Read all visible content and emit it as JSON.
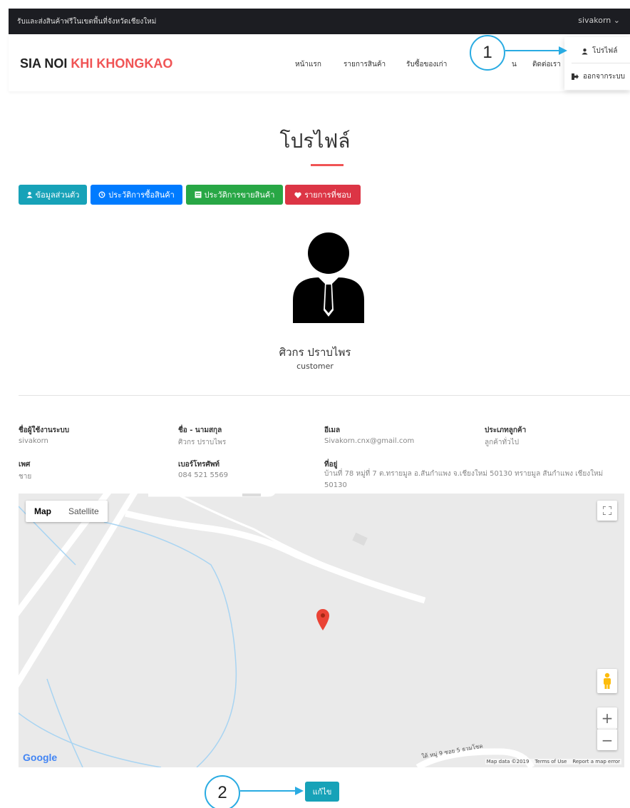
{
  "topbar": {
    "promo": "รับและส่งสินค้าฟรีในเขตพื้นที่จังหวัดเชียงใหม่",
    "username": "sivakorn",
    "caret": "⌄"
  },
  "logo": {
    "part1": "SIA NOI ",
    "part2": "KHI KHONGKAO"
  },
  "nav": {
    "home": "หน้าแรก",
    "products": "รายการสินค้า",
    "buy_old": "รับซื้อของเก่า",
    "obscured": "น",
    "contact": "ติดต่อเรา"
  },
  "dropdown": {
    "profile": "โปรไฟล์",
    "logout": "ออกจากระบบ"
  },
  "page": {
    "title": "โปรไฟล์"
  },
  "tabs": {
    "personal": "ข้อมูลส่วนตัว",
    "purchase_history": "ประวัติการซื้อสินค้า",
    "sales_history": "ประวัติการขายสินค้า",
    "favorites": "รายการที่ชอบ"
  },
  "profile": {
    "name": "ศิวกร ปราบไพร",
    "role": "customer"
  },
  "info": {
    "username_label": "ชื่อผู้ใช้งานระบบ",
    "username": "sivakorn",
    "fullname_label": "ชื่อ - นามสกุล",
    "fullname": "ศิวกร ปราบไพร",
    "email_label": "อีเมล",
    "email": "Sivakorn.cnx@gmail.com",
    "customer_type_label": "ประเภทลูกค้า",
    "customer_type": "ลูกค้าทั่วไป",
    "gender_label": "เพศ",
    "gender": "ชาย",
    "phone_label": "เบอร์โทรศัพท์",
    "phone": "084 521 5569",
    "address_label": "ที่อยู่",
    "address": "บ้านที่ 78 หมู่ที่ 7 ต.ทรายมูล อ.สันกำแพง จ.เชียงใหม่ 50130 ทรายมูล สันกำแพง เชียงใหม่ 50130"
  },
  "map": {
    "map_label": "Map",
    "satellite_label": "Satellite",
    "zoom_in": "+",
    "zoom_out": "−",
    "google": "Google",
    "data": "Map data ©2019",
    "terms": "Terms of Use",
    "report": "Report a map error",
    "road_label": "ใต้ หมู่ 9 ซอย 5 ธวมโชค"
  },
  "edit_button": "แก้ไข",
  "callouts": {
    "one": "1",
    "two": "2"
  },
  "colors": {
    "accent": "#f05455",
    "personal": "#17a2b8",
    "purchase": "#007bff",
    "sales": "#28a745",
    "favorites": "#dc3545",
    "callout": "#29abe2"
  },
  "icons": {
    "personal": "user-icon",
    "purchase": "history-icon",
    "sales": "list-icon",
    "favorites": "heart-icon",
    "profile": "user-icon",
    "logout": "sign-out-icon",
    "fullscreen": "fullscreen-icon",
    "pegman": "pegman-icon",
    "pin": "map-pin-icon"
  }
}
